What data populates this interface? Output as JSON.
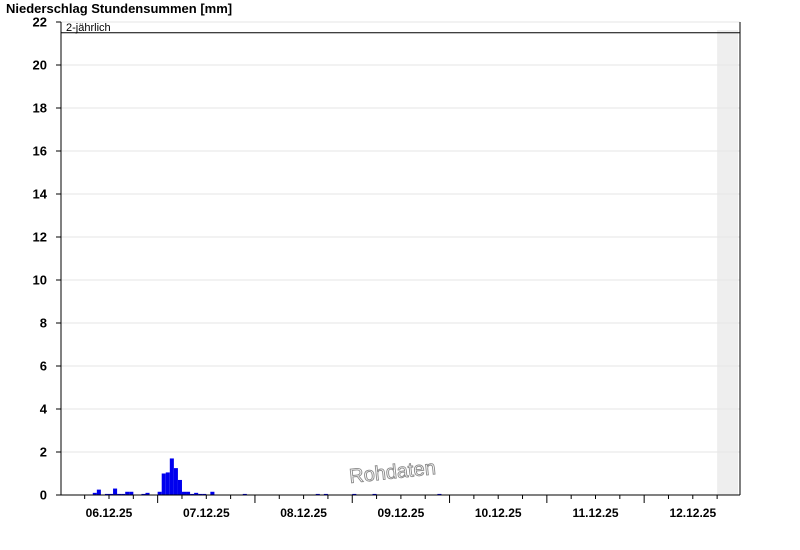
{
  "chart_data": {
    "type": "bar",
    "title": "Niederschlag Stundensummen [mm]",
    "xlabel": "",
    "ylabel": "",
    "unit": "mm",
    "ylim": [
      0,
      22
    ],
    "yticks": [
      0,
      2,
      4,
      6,
      8,
      10,
      12,
      14,
      16,
      18,
      20,
      22
    ],
    "xlim_hours": [
      0,
      168
    ],
    "x_ticks": [
      {
        "label": "06.12.25",
        "hour": 0
      },
      {
        "label": "07.12.25",
        "hour": 24
      },
      {
        "label": "08.12.25",
        "hour": 48
      },
      {
        "label": "09.12.25",
        "hour": 72
      },
      {
        "label": "10.12.25",
        "hour": 96
      },
      {
        "label": "11.12.25",
        "hour": 120
      },
      {
        "label": "12.12.25",
        "hour": 144
      }
    ],
    "forecast_region_start_hour": 150,
    "reference_line": {
      "label": "2-jährlich",
      "value": 21.5
    },
    "watermark": "Rohdaten",
    "grid": true,
    "colors": {
      "bars": "#0000ee",
      "grid": "#e6e6e6",
      "forecast_shade": "#eeeeee"
    },
    "series": [
      {
        "color": "#0000ee",
        "hours": [
          -4,
          -3,
          -1,
          0,
          1,
          2,
          3,
          4,
          5,
          8,
          9,
          12,
          13,
          14,
          15,
          16,
          17,
          18,
          19,
          20,
          21,
          22,
          23,
          25,
          33,
          51,
          53,
          60,
          65,
          81
        ],
        "values": [
          0.1,
          0.25,
          0.05,
          0.05,
          0.3,
          0.05,
          0.05,
          0.15,
          0.15,
          0.05,
          0.1,
          0.15,
          1.0,
          1.05,
          1.7,
          1.25,
          0.7,
          0.15,
          0.15,
          0.05,
          0.1,
          0.05,
          0.05,
          0.15,
          0.05,
          0.05,
          0.05,
          0.05,
          0.05,
          0.05
        ]
      }
    ]
  }
}
